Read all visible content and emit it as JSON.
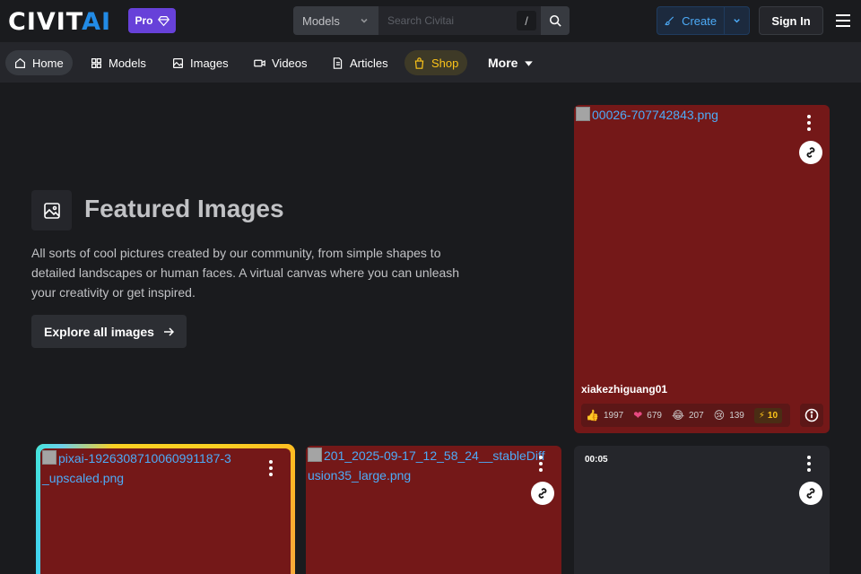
{
  "header": {
    "logo_main": "CIVIT",
    "logo_accent": "AI",
    "pro_label": "Pro",
    "search_scope": "Models",
    "search_placeholder": "Search Civitai",
    "search_shortcut": "/",
    "create_label": "Create",
    "signin_label": "Sign In"
  },
  "nav": {
    "items": [
      {
        "label": "Home",
        "icon": "home-icon"
      },
      {
        "label": "Models",
        "icon": "grid-icon"
      },
      {
        "label": "Images",
        "icon": "image-icon"
      },
      {
        "label": "Videos",
        "icon": "video-icon"
      },
      {
        "label": "Articles",
        "icon": "article-icon"
      },
      {
        "label": "Shop",
        "icon": "shopping-bag-icon"
      },
      {
        "label": "More",
        "icon": "caret-down-icon"
      }
    ]
  },
  "hero": {
    "title": "Featured Images",
    "description": "All sorts of cool pictures created by our community, from simple shapes to detailed landscapes or human faces. A virtual canvas where you can unleash your creativity or get inspired.",
    "cta": "Explore all images"
  },
  "cards": {
    "featured": {
      "filename": "00026-707742843.png",
      "author": "xiakezhiguang01",
      "reactions": {
        "like": "1997",
        "heart": "679",
        "laugh": "207",
        "cry": "139",
        "buzz": "10"
      }
    },
    "glow": {
      "filename": "pixai-1926308710060991187-3_upscaled.png"
    },
    "middle": {
      "filename": "201_2025-09-17_12_58_24__stableDiffusion35_large.png"
    },
    "video": {
      "duration": "00:05"
    }
  },
  "colors": {
    "background": "#1a1b1e",
    "navbar": "#25262b",
    "pro_badge": "#6741d9",
    "accent_blue": "#228be6",
    "card_red": "#741818",
    "shop_yellow": "#fcc419"
  }
}
